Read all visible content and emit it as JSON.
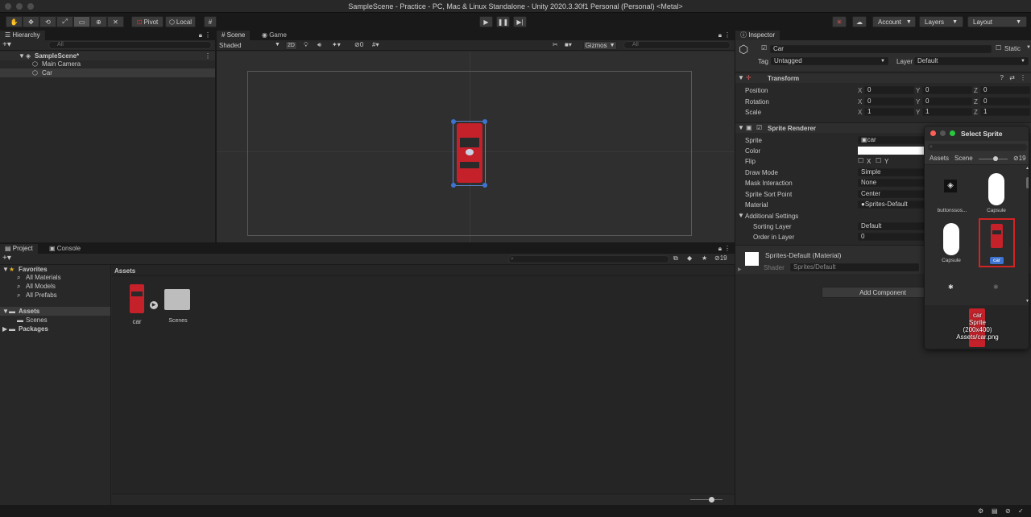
{
  "window": {
    "title": "SampleScene - Practice - PC, Mac & Linux Standalone - Unity 2020.3.30f1 Personal (Personal) <Metal>"
  },
  "toolbar": {
    "tools": [
      "hand-tool",
      "move-tool",
      "rotate-tool",
      "scale-tool",
      "rect-tool",
      "transform-tool",
      "custom-tool"
    ],
    "pivot_label": "Pivot",
    "local_label": "Local",
    "account_label": "Account",
    "layers_label": "Layers",
    "layout_label": "Layout"
  },
  "hierarchy": {
    "tab_label": "Hierarchy",
    "search_placeholder": "All",
    "scene_label": "SampleScene*",
    "items": [
      "Main Camera",
      "Car"
    ]
  },
  "scene": {
    "tabs": [
      "Scene",
      "Game"
    ],
    "shading_label": "Shaded",
    "mode_2d": "2D",
    "hidden_count": "0",
    "gizmos_label": "Gizmos",
    "search_placeholder": "All"
  },
  "project": {
    "tabs": [
      "Project",
      "Console"
    ],
    "favorites_label": "Favorites",
    "favorites": [
      "All Materials",
      "All Models",
      "All Prefabs"
    ],
    "assets_label": "Assets",
    "asset_folders": [
      "Scenes"
    ],
    "packages_label": "Packages",
    "breadcrumb": "Assets",
    "grid_items": [
      "car",
      "Scenes"
    ],
    "count": "19"
  },
  "inspector": {
    "tab_label": "Inspector",
    "object_name": "Car",
    "static_label": "Static",
    "tag_label": "Tag",
    "tag_value": "Untagged",
    "layer_label": "Layer",
    "layer_value": "Default",
    "transform": {
      "title": "Transform",
      "rows": [
        {
          "label": "Position",
          "x": "0",
          "y": "0",
          "z": "0"
        },
        {
          "label": "Rotation",
          "x": "0",
          "y": "0",
          "z": "0"
        },
        {
          "label": "Scale",
          "x": "1",
          "y": "1",
          "z": "1"
        }
      ]
    },
    "sprite_renderer": {
      "title": "Sprite Renderer",
      "sprite_label": "Sprite",
      "sprite_value": "car",
      "color_label": "Color",
      "flip_label": "Flip",
      "flip_x": "X",
      "flip_y": "Y",
      "draw_mode_label": "Draw Mode",
      "draw_mode_value": "Simple",
      "mask_label": "Mask Interaction",
      "mask_value": "None",
      "sort_point_label": "Sprite Sort Point",
      "sort_point_value": "Center",
      "material_label": "Material",
      "material_value": "Sprites-Default",
      "additional_label": "Additional Settings",
      "sorting_layer_label": "Sorting Layer",
      "sorting_layer_value": "Default",
      "order_label": "Order in Layer",
      "order_value": "0"
    },
    "material": {
      "name": "Sprites-Default (Material)",
      "shader_label": "Shader",
      "shader_value": "Sprites/Default"
    },
    "add_component_label": "Add Component"
  },
  "select_sprite": {
    "title": "Select Sprite",
    "tab_assets": "Assets",
    "tab_scene": "Scene",
    "count": "19",
    "items": [
      "buttonssos...",
      "Capsule",
      "Capsule",
      "car"
    ],
    "preview_name": "car",
    "preview_type": "Sprite",
    "preview_size": "(200x400)",
    "preview_path": "Assets/car.png"
  },
  "colors": {
    "accent": "#3d74d1",
    "selection_outline": "#d32424",
    "car_red": "#d8232a"
  }
}
